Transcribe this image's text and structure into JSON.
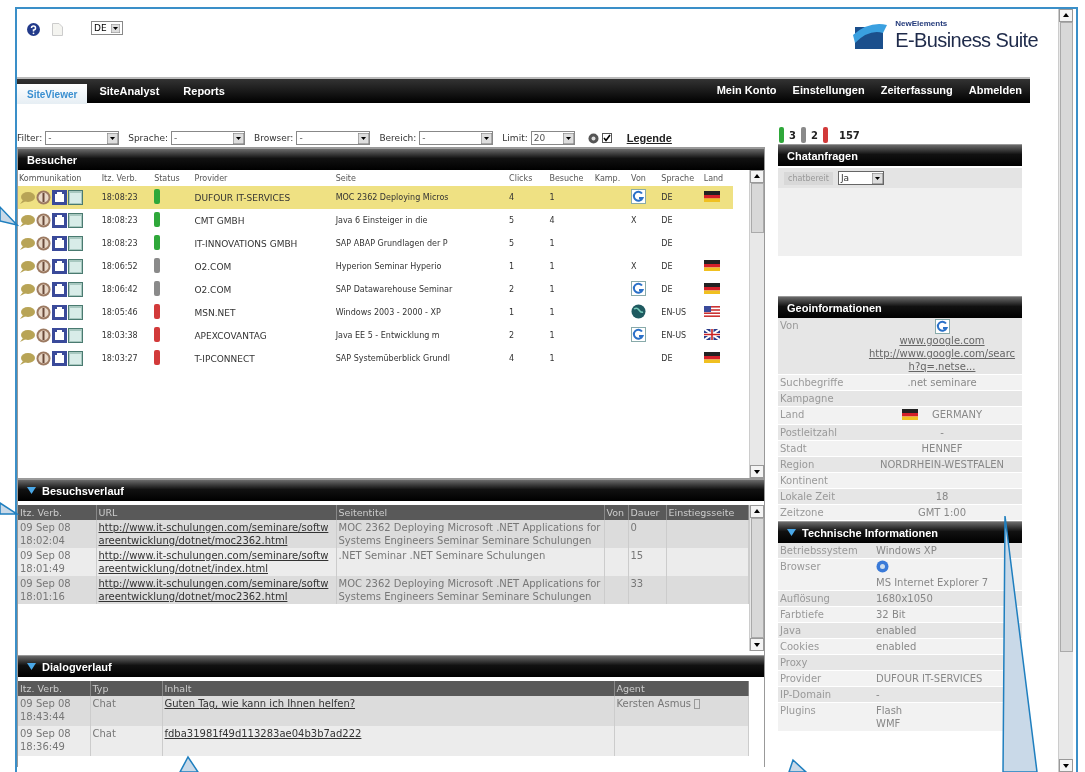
{
  "header": {
    "language": "DE",
    "brand_top": "NewElements",
    "brand": "E-Business Suite"
  },
  "nav": {
    "tabs": [
      {
        "label": "SiteViewer",
        "selected": true
      },
      {
        "label": "SiteAnalyst",
        "selected": false
      },
      {
        "label": "Reports",
        "selected": false
      }
    ],
    "links": [
      "Mein Konto",
      "Einstellungen",
      "Zeiterfassung",
      "Abmelden"
    ]
  },
  "filters": [
    {
      "label": "Filter:",
      "value": "-"
    },
    {
      "label": "Sprache:",
      "value": "-"
    },
    {
      "label": "Browser:",
      "value": "-"
    },
    {
      "label": "Bereich:",
      "value": "-"
    },
    {
      "label": "Limit:",
      "value": "20"
    }
  ],
  "legend": {
    "checked": true,
    "label": "Legende"
  },
  "visitors": {
    "title": "Besucher",
    "toggle": false,
    "columns": [
      "Kommunikation",
      "Itz. Verb.",
      "Status",
      "Provider",
      "Seite",
      "Clicks",
      "Besuche",
      "Kamp.",
      "Von",
      "Sprache",
      "Land"
    ],
    "rows": [
      {
        "selected": true,
        "time": "18:08:23",
        "color": "#2fa83a",
        "provider": "DUFOUR IT-SERVICES",
        "page": "MOC 2362 Deploying Micros",
        "clicks": "4",
        "visits": "1",
        "from": {
          "kind": "search"
        },
        "language": "DE",
        "flag": {
          "kind": "de"
        }
      },
      {
        "selected": false,
        "time": "18:08:23",
        "color": "#2fa83a",
        "provider": "CMT GMBH",
        "page": "Java 6 Einsteiger in die",
        "clicks": "5",
        "visits": "4",
        "from": {
          "kind": "text",
          "text": "X"
        },
        "language": "DE"
      },
      {
        "selected": false,
        "time": "18:08:23",
        "color": "#2fa83a",
        "provider": "IT-INNOVATIONS GMBH",
        "page": "SAP ABAP Grundlagen der P",
        "clicks": "5",
        "visits": "1",
        "language": "DE"
      },
      {
        "selected": false,
        "time": "18:06:52",
        "color": "#8a8a8a",
        "provider": "O2.COM",
        "page": "Hyperion Seminar Hyperio",
        "clicks": "1",
        "visits": "1",
        "from": {
          "kind": "text",
          "text": "X"
        },
        "language": "DE",
        "flag": {
          "kind": "de"
        }
      },
      {
        "selected": false,
        "time": "18:06:42",
        "color": "#8a8a8a",
        "provider": "O2.COM",
        "page": "SAP Datawarehouse Seminar",
        "clicks": "2",
        "visits": "1",
        "from": {
          "kind": "search"
        },
        "language": "DE",
        "flag": {
          "kind": "de"
        }
      },
      {
        "selected": false,
        "time": "18:05:46",
        "color": "#d23a3a",
        "provider": "MSN.NET",
        "page": "Windows 2003 - 2000 - XP",
        "clicks": "1",
        "visits": "1",
        "from": {
          "kind": "globe"
        },
        "language": "EN-US",
        "flag": {
          "kind": "us"
        }
      },
      {
        "selected": false,
        "time": "18:03:38",
        "color": "#d23a3a",
        "provider": "APEXCOVANTAG",
        "page": "Java EE 5 - Entwicklung m",
        "clicks": "2",
        "visits": "1",
        "from": {
          "kind": "search"
        },
        "language": "EN-US",
        "flag": {
          "kind": "gb"
        }
      },
      {
        "selected": false,
        "time": "18:03:27",
        "color": "#d23a3a",
        "provider": "T-IPCONNECT",
        "page": "SAP Systemüberblick Grundl",
        "clicks": "4",
        "visits": "1",
        "language": "DE",
        "flag": {
          "kind": "de"
        }
      }
    ]
  },
  "history": {
    "title": "Besuchsverlauf",
    "toggle": true,
    "columns": [
      "Itz. Verb.",
      "URL",
      "Seitentitel",
      "Von",
      "Dauer",
      "Einstiegsseite"
    ],
    "rows": [
      {
        "time": "09 Sep 08 18:02:04",
        "url": "http://www.it-schulungen.com/seminare/softwareentwicklung/dotnet/moc2362.html",
        "title": "MOC 2362 Deploying Microsoft .NET Applications for Systems Engineers Seminar Seminare Schulungen",
        "duration": "0"
      },
      {
        "time": "09 Sep 08 18:01:49",
        "url": "http://www.it-schulungen.com/seminare/softwareentwicklung/dotnet/index.html",
        "title": ".NET Seminar .NET Seminare Schulungen",
        "duration": "15"
      },
      {
        "time": "09 Sep 08 18:01:16",
        "url": "http://www.it-schulungen.com/seminare/softwareentwicklung/dotnet/moc2362.html",
        "title": "MOC 2362 Deploying Microsoft .NET Applications for Systems Engineers Seminar Seminare Schulungen",
        "duration": "33"
      }
    ]
  },
  "dialog": {
    "title": "Dialogverlauf",
    "toggle": true,
    "columns": [
      "Itz. Verb.",
      "Typ",
      "Inhalt",
      "Agent"
    ],
    "rows": [
      {
        "time": "09 Sep 08 18:43:44",
        "type": "Chat",
        "content": "Guten Tag, wie kann ich Ihnen helfen?",
        "agent": "Kersten Asmus"
      },
      {
        "time": "09 Sep 08 18:36:49",
        "type": "Chat",
        "content": "fdba31981f49d113283ae04b3b7ad222"
      }
    ]
  },
  "counters": {
    "items": [
      {
        "color": "#2fa83a",
        "value": "3"
      },
      {
        "color": "#8a8a8a",
        "value": "2"
      },
      {
        "color": "#d23a3a"
      }
    ],
    "total": "157"
  },
  "chat": {
    "title": "Chatanfragen",
    "toggle": false,
    "label": "chatbereit",
    "value": "Ja"
  },
  "geo": {
    "title": "Geoinformationen",
    "toggle": false,
    "rows": [
      {
        "label": "Von",
        "kind": "referrer",
        "links": [
          "www.google.com",
          "http://www.google.com/search?q=.netse..."
        ]
      },
      {
        "label": "Suchbegriffe",
        "value": ".net seminare"
      },
      {
        "label": "Kampagne"
      },
      {
        "label": "Land",
        "kind": "country",
        "flag": {
          "kind": "de"
        },
        "value": "GERMANY"
      },
      {
        "label": "Postleitzahl",
        "value": "-"
      },
      {
        "label": "Stadt",
        "value": "HENNEF"
      },
      {
        "label": "Region",
        "value": "NORDRHEIN-WESTFALEN"
      },
      {
        "label": "Kontinent"
      },
      {
        "label": "Lokale Zeit",
        "value": "18"
      },
      {
        "label": "Zeitzone",
        "value": "GMT 1:00"
      }
    ]
  },
  "tech": {
    "title": "Technische Informationen",
    "toggle": true,
    "rows": [
      {
        "label": "Betriebssystem",
        "value": "Windows XP"
      },
      {
        "label": "Browser",
        "kind": "browser",
        "value": "MS Internet Explorer 7"
      },
      {
        "label": "Auflösung",
        "value": "1680x1050"
      },
      {
        "label": "Farbtiefe",
        "value": "32 Bit"
      },
      {
        "label": "Java",
        "value": "enabled"
      },
      {
        "label": "Cookies",
        "value": "enabled"
      },
      {
        "label": "Proxy"
      },
      {
        "label": "Provider",
        "value": "DUFOUR IT-SERVICES"
      },
      {
        "label": "IP-Domain",
        "value": "-"
      },
      {
        "label": "Plugins",
        "kind": "list",
        "values": [
          "Flash",
          "WMF"
        ]
      }
    ]
  }
}
